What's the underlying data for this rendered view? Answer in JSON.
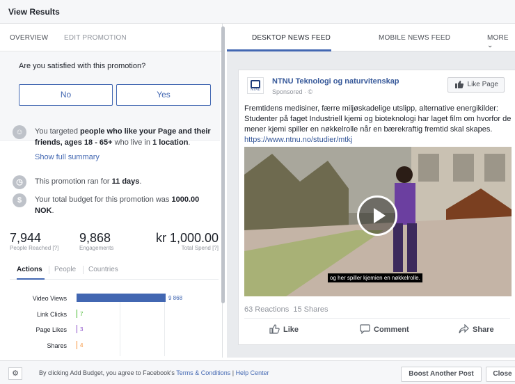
{
  "window": {
    "title": "View Results"
  },
  "left_tabs": [
    "OVERVIEW",
    "EDIT PROMOTION"
  ],
  "survey": {
    "question": "Are you satisfied with this promotion?",
    "no_label": "No",
    "yes_label": "Yes"
  },
  "targeting": {
    "prefix": "You targeted ",
    "audience": "people who like your Page and their friends, ages 18 - 65+",
    "mid": " who live in ",
    "locations": "1 location",
    "suffix": "."
  },
  "show_summary": "Show full summary",
  "duration": {
    "prefix": "This promotion ran for ",
    "value": "11 days",
    "suffix": "."
  },
  "budget": {
    "prefix": "Your total budget for this promotion was ",
    "value": "1000.00 NOK",
    "suffix": "."
  },
  "stats": {
    "reached": {
      "value": "7,944",
      "label": "People Reached [?]"
    },
    "engagements": {
      "value": "9,868",
      "label": "Engagements"
    },
    "spend": {
      "value": "kr 1,000.00",
      "label": "Total Spend [?]"
    }
  },
  "action_tabs": [
    "Actions",
    "People",
    "Countries"
  ],
  "chart_data": {
    "type": "bar",
    "orientation": "horizontal",
    "categories": [
      "Video Views",
      "Link Clicks",
      "Page Likes",
      "Shares"
    ],
    "values": [
      9868,
      7,
      3,
      4
    ],
    "value_labels": [
      "9 868",
      "7",
      "3",
      "4"
    ],
    "colors": [
      "#4267b2",
      "#42b72a",
      "#8b4fc9",
      "#f7923a"
    ],
    "xlim": [
      0,
      9868
    ]
  },
  "right_tabs": [
    "DESKTOP NEWS FEED",
    "MOBILE NEWS FEED",
    "MORE"
  ],
  "post": {
    "logo_text": "NTNU",
    "page_name": "NTNU Teknologi og naturvitenskap",
    "sponsored": "Sponsored · ©",
    "like_page": "Like Page",
    "text": "Fremtidens medisiner, færre miljøskadelige utslipp, alternative energikilder: Studenter på faget Industriell kjemi og bioteknologi har laget film om hvorfor de mener kjemi spiller en nøkkelrolle når en bærekraftig fremtid skal skapes.",
    "link": "https://www.ntnu.no/studier/mtkj",
    "video_caption": "og her spiller kjemien en nøkkelrolle.",
    "reactions": "63 Reactions",
    "shares": "15 Shares",
    "actions": [
      "Like",
      "Comment",
      "Share"
    ]
  },
  "footer": {
    "text_prefix": "By clicking Add Budget, you agree to Facebook's ",
    "terms": "Terms & Conditions",
    "sep": " | ",
    "help": "Help Center",
    "boost_button": "Boost Another Post",
    "close_button": "Close"
  }
}
